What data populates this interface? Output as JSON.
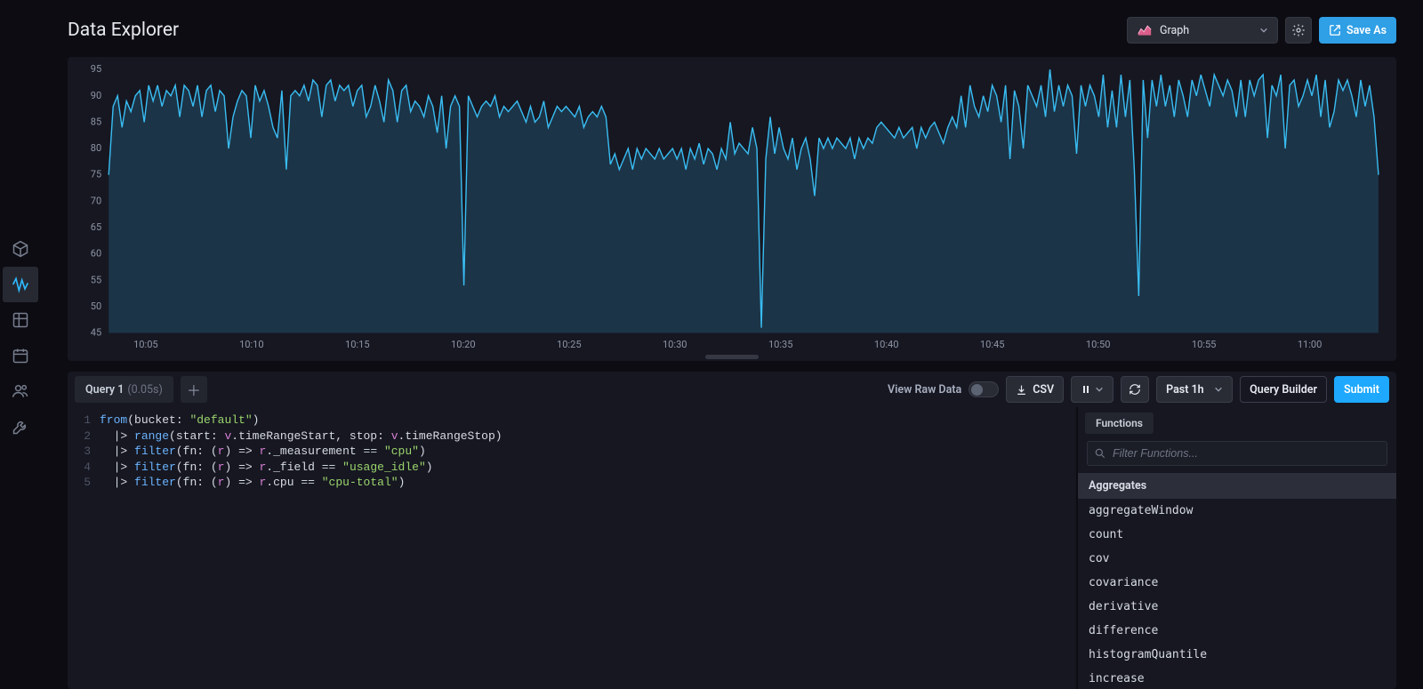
{
  "header": {
    "title": "Data Explorer",
    "viz_type": "Graph",
    "save_as": "Save As"
  },
  "sidebar": {
    "items": [
      {
        "name": "cube-icon"
      },
      {
        "name": "activity-icon"
      },
      {
        "name": "grid-icon"
      },
      {
        "name": "calendar-icon"
      },
      {
        "name": "users-icon"
      },
      {
        "name": "wrench-icon"
      }
    ],
    "activeIndex": 1
  },
  "query_tabs": {
    "active": {
      "label": "Query 1",
      "duration": "(0.05s)"
    }
  },
  "toolbar": {
    "raw_label": "View Raw Data",
    "csv_label": "CSV",
    "time_range": "Past 1h",
    "builder_label": "Query Builder",
    "submit_label": "Submit"
  },
  "code": {
    "lines": [
      {
        "n": 1,
        "html": "<span class='fn'>from</span>(bucket: <span class='str'>\"default\"</span>)"
      },
      {
        "n": 2,
        "html": "  <span class='pipe'>|&gt;</span> <span class='fn'>range</span>(start: <span class='var'>v</span>.timeRangeStart, stop: <span class='var'>v</span>.timeRangeStop)"
      },
      {
        "n": 3,
        "html": "  <span class='pipe'>|&gt;</span> <span class='fn'>filter</span>(fn: (<span class='ident'>r</span>) =&gt; <span class='ident'>r</span>._measurement <span class='op'>==</span> <span class='str'>\"cpu\"</span>)"
      },
      {
        "n": 4,
        "html": "  <span class='pipe'>|&gt;</span> <span class='fn'>filter</span>(fn: (<span class='ident'>r</span>) =&gt; <span class='ident'>r</span>._field <span class='op'>==</span> <span class='str'>\"usage_idle\"</span>)"
      },
      {
        "n": 5,
        "html": "  <span class='pipe'>|&gt;</span> <span class='fn'>filter</span>(fn: (<span class='ident'>r</span>) =&gt; <span class='ident'>r</span>.cpu <span class='op'>==</span> <span class='str'>\"cpu-total\"</span>)"
      }
    ]
  },
  "functions": {
    "tab_label": "Functions",
    "search_placeholder": "Filter Functions...",
    "category": "Aggregates",
    "items": [
      "aggregateWindow",
      "count",
      "cov",
      "covariance",
      "derivative",
      "difference",
      "histogramQuantile",
      "increase"
    ]
  },
  "chart_data": {
    "type": "line",
    "title": "",
    "xlabel": "",
    "ylabel": "",
    "ylim": [
      45,
      95
    ],
    "y_ticks": [
      45,
      50,
      55,
      60,
      65,
      70,
      75,
      80,
      85,
      90,
      95
    ],
    "x_labels": [
      "10:05",
      "10:10",
      "10:15",
      "10:20",
      "10:25",
      "10:30",
      "10:35",
      "10:40",
      "10:45",
      "10:50",
      "10:55",
      "11:00"
    ],
    "series": [
      {
        "name": "usage_idle cpu-total",
        "color": "#39bdf3",
        "values": [
          75,
          88,
          90,
          84,
          89,
          87,
          90,
          91,
          85,
          92,
          89,
          92,
          88,
          91,
          90,
          92,
          86,
          92,
          91,
          88,
          92,
          86,
          91,
          92,
          87,
          91,
          90,
          80,
          86,
          89,
          91,
          90,
          82,
          92,
          89,
          91,
          88,
          84,
          82,
          91,
          76,
          90,
          91,
          90,
          92,
          89,
          93,
          92,
          86,
          92,
          93,
          89,
          92,
          91,
          92,
          88,
          91,
          92,
          86,
          88,
          92,
          89,
          85,
          93,
          91,
          85,
          91,
          92,
          87,
          89,
          88,
          86,
          90,
          88,
          83,
          90,
          80,
          88,
          90,
          88,
          54,
          90,
          88,
          86,
          88,
          89,
          88,
          90,
          86,
          88,
          87,
          88,
          89,
          87,
          85,
          88,
          85,
          86,
          89,
          84,
          86,
          88,
          87,
          88,
          87,
          86,
          88,
          84,
          86,
          87,
          86,
          88,
          86,
          77,
          79,
          76,
          78,
          80,
          76,
          80,
          78,
          80,
          79,
          78,
          80,
          78,
          79,
          80,
          78,
          80,
          76,
          80,
          78,
          81,
          77,
          80,
          79,
          76,
          80,
          78,
          85,
          79,
          81,
          80,
          79,
          84,
          80,
          46,
          78,
          86,
          79,
          84,
          80,
          78,
          82,
          76,
          80,
          82,
          78,
          71,
          82,
          80,
          82,
          80,
          82,
          81,
          80,
          82,
          78,
          82,
          80,
          82,
          81,
          84,
          85,
          84,
          83,
          82,
          84,
          82,
          83,
          84,
          80,
          84,
          82,
          84,
          85,
          83,
          81,
          84,
          86,
          84,
          90,
          84,
          92,
          88,
          86,
          90,
          87,
          92,
          90,
          85,
          92,
          78,
          91,
          88,
          80,
          92,
          90,
          88,
          92,
          86,
          95,
          87,
          92,
          88,
          92,
          90,
          79,
          92,
          88,
          92,
          90,
          86,
          94,
          84,
          91,
          84,
          94,
          86,
          93,
          76,
          52,
          93,
          82,
          93,
          88,
          94,
          88,
          92,
          86,
          93,
          90,
          86,
          93,
          90,
          94,
          91,
          88,
          94,
          92,
          90,
          93,
          91,
          86,
          93,
          86,
          93,
          90,
          93,
          94,
          82,
          92,
          90,
          94,
          80,
          92,
          93,
          88,
          90,
          93,
          90,
          94,
          86,
          93,
          84,
          87,
          93,
          91,
          93,
          90,
          86,
          93,
          88,
          92,
          86,
          75
        ]
      }
    ]
  }
}
